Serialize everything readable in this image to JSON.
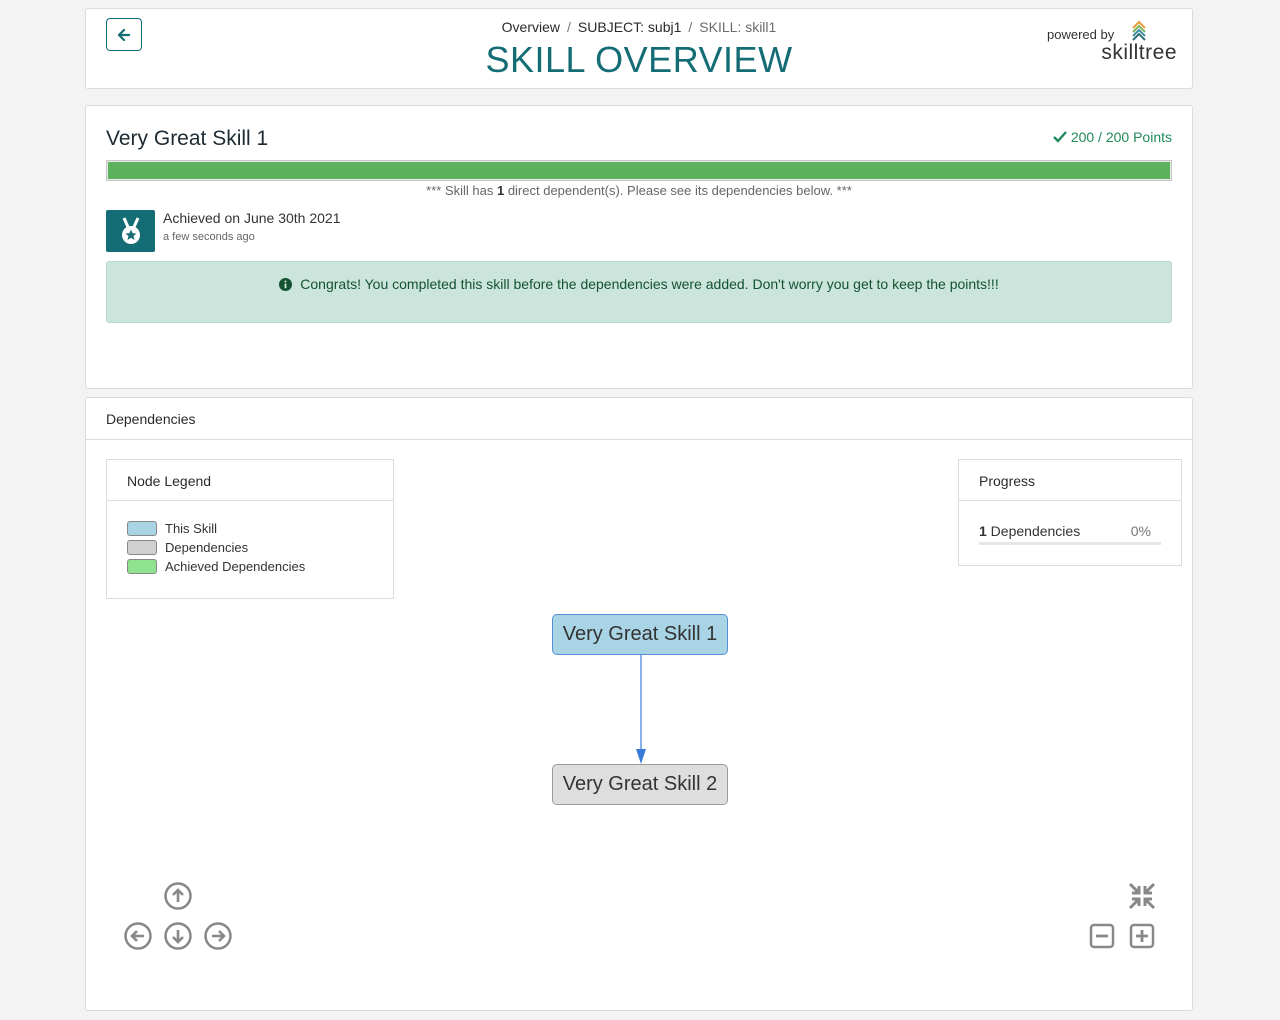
{
  "header": {
    "breadcrumb": {
      "overview": "Overview",
      "subject": "SUBJECT: subj1",
      "skill": "SKILL: skill1",
      "separator": "/"
    },
    "title": "SKILL OVERVIEW",
    "powered_by": "powered by",
    "brand": "skilltree"
  },
  "skill": {
    "name": "Very Great Skill 1",
    "points": "200 / 200 Points",
    "progress_fraction": 1.0,
    "dep_note_prefix": "*** Skill has ",
    "dep_note_count": "1",
    "dep_note_suffix": " direct dependent(s). Please see its dependencies below. ***",
    "achieved": "Achieved on June 30th 2021",
    "achieved_ago": "a few seconds ago",
    "alert": "Congrats! You completed this skill before the dependencies were added. Don't worry you get to keep the points!!!"
  },
  "dependencies": {
    "title": "Dependencies",
    "legend": {
      "title": "Node Legend",
      "items": [
        {
          "label": "This Skill",
          "color": "#a8d4e6"
        },
        {
          "label": "Dependencies",
          "color": "#d0d0d0"
        },
        {
          "label": "Achieved Dependencies",
          "color": "#8fe38f"
        }
      ]
    },
    "progress": {
      "title": "Progress",
      "count": "1",
      "label": " Dependencies",
      "percent": "0%",
      "fraction": 0
    },
    "nodes": {
      "this_skill": "Very Great Skill 1",
      "dependency": "Very Great Skill 2"
    }
  },
  "colors": {
    "brand": "#146c75",
    "success": "#5cb25c",
    "edge": "#3a7bd5"
  }
}
